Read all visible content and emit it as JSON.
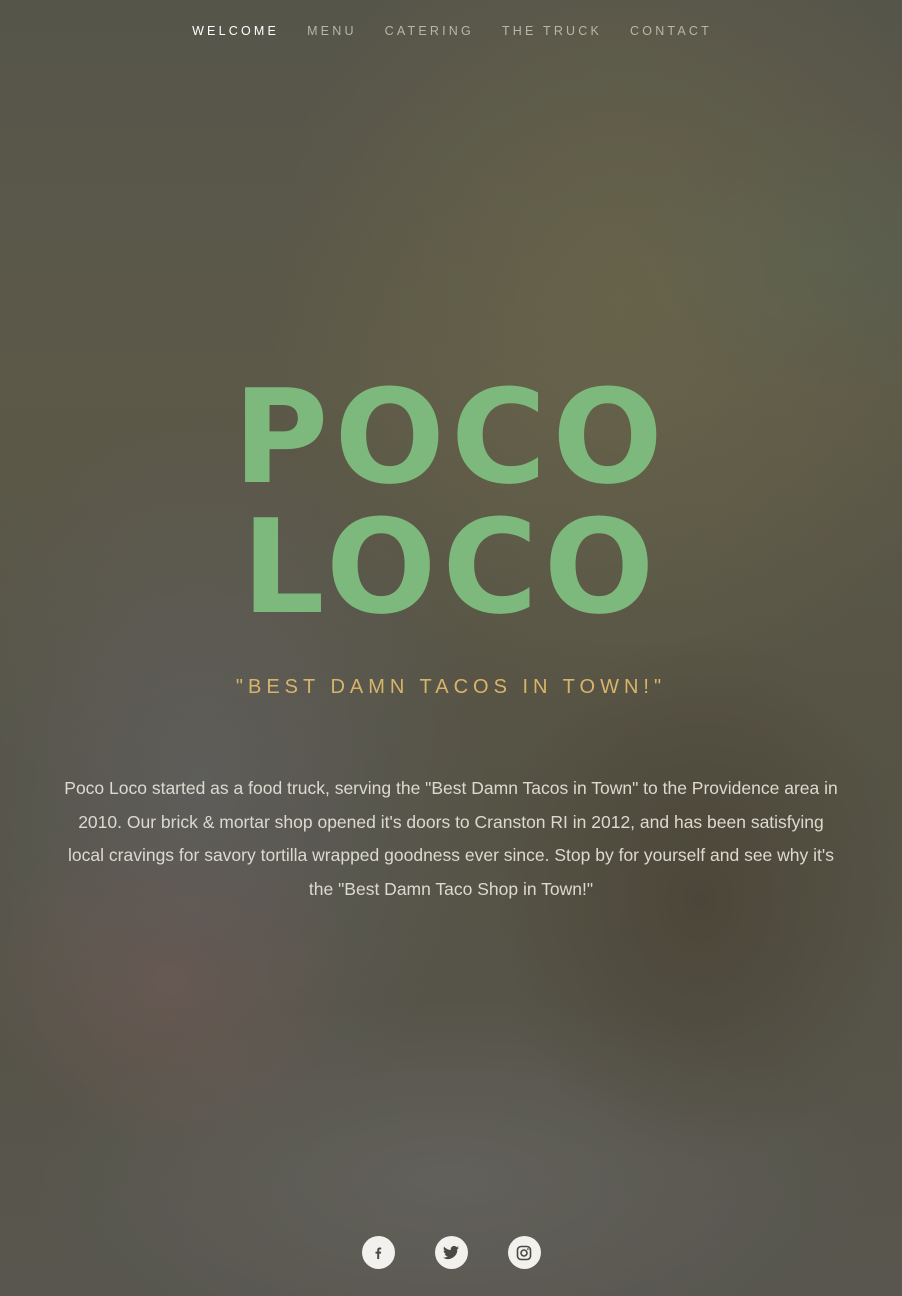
{
  "nav": {
    "items": [
      {
        "label": "WELCOME",
        "active": true
      },
      {
        "label": "MENU",
        "active": false
      },
      {
        "label": "CATERING",
        "active": false
      },
      {
        "label": "THE TRUCK",
        "active": false
      },
      {
        "label": "CONTACT",
        "active": false
      }
    ]
  },
  "hero": {
    "title_line1": "POCO",
    "title_line2": "LOCO",
    "tagline": "\"BEST DAMN TACOS IN TOWN!\"",
    "about": "Poco Loco started as a food truck, serving the \"Best Damn Tacos in Town\" to the Providence area in 2010. Our brick & mortar shop opened it's doors to Cranston RI in 2012, and has been satisfying local cravings for savory tortilla wrapped goodness ever since. Stop by for yourself and see why it's the \"Best Damn Taco Shop in Town!\""
  },
  "social": {
    "icons": [
      "facebook-icon",
      "twitter-icon",
      "instagram-icon"
    ]
  },
  "colors": {
    "title": "#7db97c",
    "tagline": "#d8b46a",
    "nav_active": "#ffffff",
    "nav_inactive": "#b9b6a8"
  }
}
